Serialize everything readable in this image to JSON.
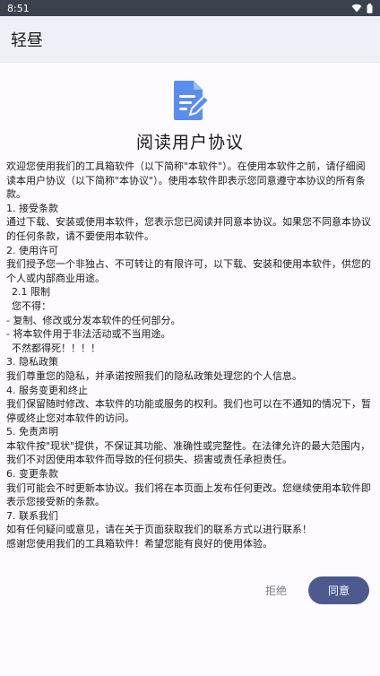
{
  "status_bar": {
    "time": "8:51",
    "icons": [
      "wifi-icon",
      "battery-icon"
    ]
  },
  "app_bar": {
    "title": "轻昼"
  },
  "agreement": {
    "icon": "document-edit-icon",
    "accent_color": "#5b8def",
    "title": "阅读用户协议",
    "lines": [
      "欢迎您使用我们的工具箱软件（以下简称\"本软件\"）。在使用本软件之前，请仔细阅读本用户协议（以下简称\"本协议\"）。使用本软件即表示您同意遵守本协议的所有条款。",
      "1. 接受条款",
      "通过下载、安装或使用本软件，您表示您已阅读并同意本协议。如果您不同意本协议的任何条款，请不要使用本软件。",
      "2. 使用许可",
      "我们授予您一个非独占、不可转让的有限许可，以下载、安装和使用本软件，供您的个人或内部商业用途。",
      " 2.1 限制",
      " 您不得：",
      " - 复制、修改或分发本软件的任何部分。",
      " - 将本软件用于非法活动或不当用途。",
      "  不然都得死！！！！",
      "3. 隐私政策",
      "我们尊重您的隐私，并承诺按照我们的隐私政策处理您的个人信息。",
      "4. 服务变更和终止",
      "我们保留随时修改、本软件的功能或服务的权利。我们也可以在不通知的情况下，暂停或终止您对本软件的访问。",
      "5. 免责声明",
      "本软件按\"现状\"提供，不保证其功能、准确性或完整性。在法律允许的最大范围内，我们不对因使用本软件而导致的任何损失、损害或责任承担责任。",
      "6. 变更条款",
      "我们可能会不时更新本协议。我们将在本页面上发布任何更改。您继续使用本软件即表示您接受新的条款。",
      "7. 联系我们",
      "如有任何疑问或意见，请在关于页面获取我们的联系方式以进行联系！",
      "感谢您使用我们的工具箱软件！希望您能有良好的使用体验。"
    ]
  },
  "actions": {
    "reject_label": "拒绝",
    "agree_label": "同意",
    "agree_color": "#4c5a8f"
  }
}
